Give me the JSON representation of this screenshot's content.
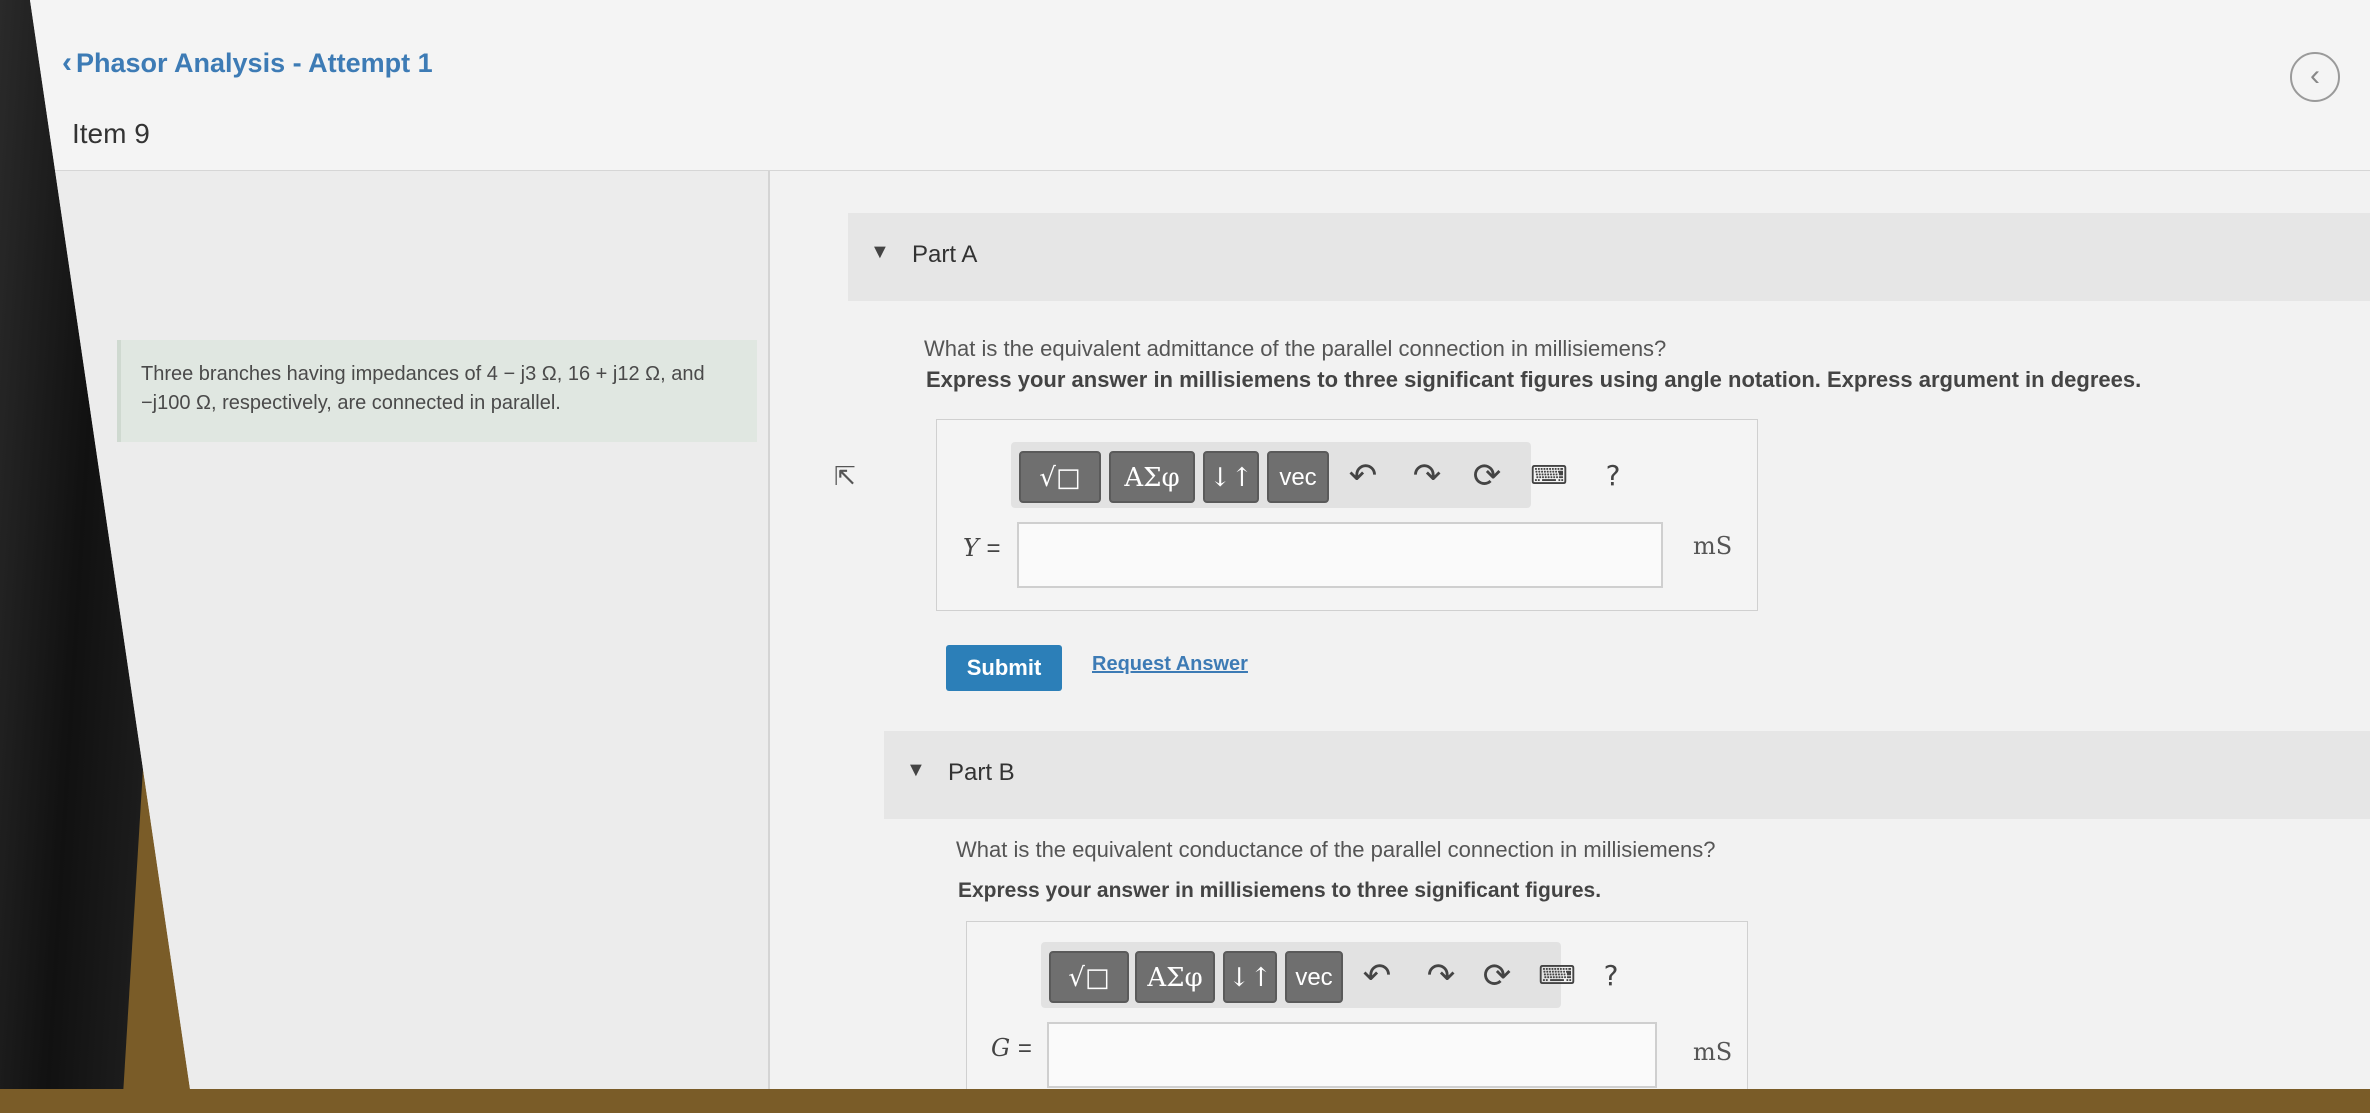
{
  "header": {
    "back_label": "Phasor Analysis - Attempt 1",
    "item_title": "Item 9"
  },
  "problem": {
    "text": "Three branches having impedances of 4 − j3 Ω, 16 + j12 Ω, and −j100 Ω, respectively, are connected in parallel."
  },
  "toolbar": {
    "buttons": [
      "√□",
      "ΑΣφ",
      "↓↑",
      "vec"
    ],
    "icons": [
      "undo-icon",
      "redo-icon",
      "reset-icon",
      "keyboard-icon",
      "help-icon"
    ],
    "help": "?"
  },
  "part_a": {
    "label": "Part A",
    "question": "What is the equivalent admittance of the parallel connection in millisiemens?",
    "instruction": "Express your answer in millisiemens to three significant figures using angle notation. Express argument in degrees.",
    "variable": "Y",
    "equals": "=",
    "value": "",
    "unit": "mS",
    "submit": "Submit",
    "request": "Request Answer"
  },
  "part_b": {
    "label": "Part B",
    "question": "What is the equivalent conductance of the parallel connection in millisiemens?",
    "instruction": "Express your answer in millisiemens to three significant figures.",
    "variable": "G",
    "equals": "=",
    "value": "",
    "unit": "mS"
  },
  "colors": {
    "accent": "#2c7fb8",
    "link": "#3d7bb5",
    "problem_bg": "#e0e7e1"
  }
}
